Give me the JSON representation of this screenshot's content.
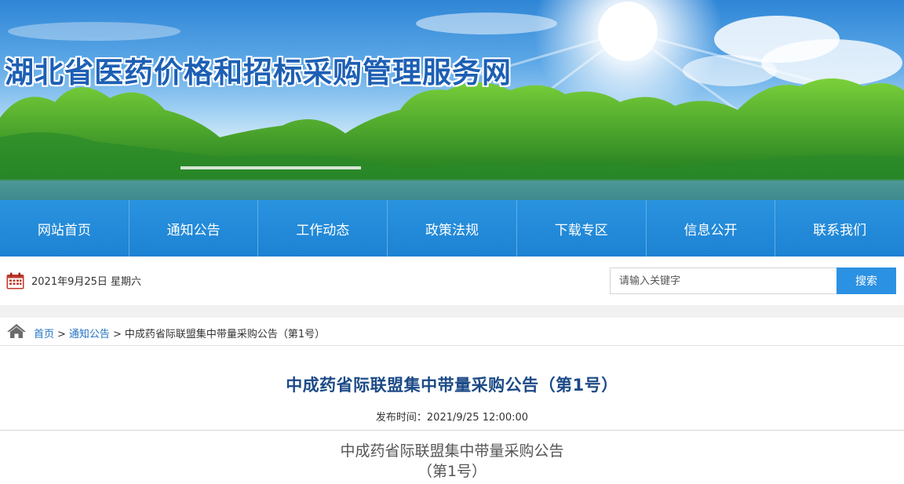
{
  "site": {
    "title": "湖北省医药价格和招标采购管理服务网"
  },
  "nav": {
    "items": [
      "网站首页",
      "通知公告",
      "工作动态",
      "政策法规",
      "下载专区",
      "信息公开",
      "联系我们"
    ]
  },
  "infobar": {
    "date": "2021年9月25日 星期六",
    "search_placeholder": "请输入关键字",
    "search_button": "搜索"
  },
  "breadcrumb": {
    "home": "首页",
    "section": "通知公告",
    "current": "中成药省际联盟集中带量采购公告（第1号）",
    "separator": ">"
  },
  "article": {
    "title": "中成药省际联盟集中带量采购公告（第1号）",
    "publish_time": "发布时间：2021/9/25 12:00:00",
    "heading_line1": "中成药省际联盟集中带量采购公告",
    "heading_line2": "（第1号）"
  },
  "colors": {
    "nav_blue": "#1d82d3",
    "title_blue": "#1c4a86",
    "link_blue": "#2272c3",
    "search_blue": "#2b91e3",
    "calendar_red": "#c0392b"
  },
  "icons": {
    "calendar": "calendar-icon",
    "home": "home-icon"
  }
}
